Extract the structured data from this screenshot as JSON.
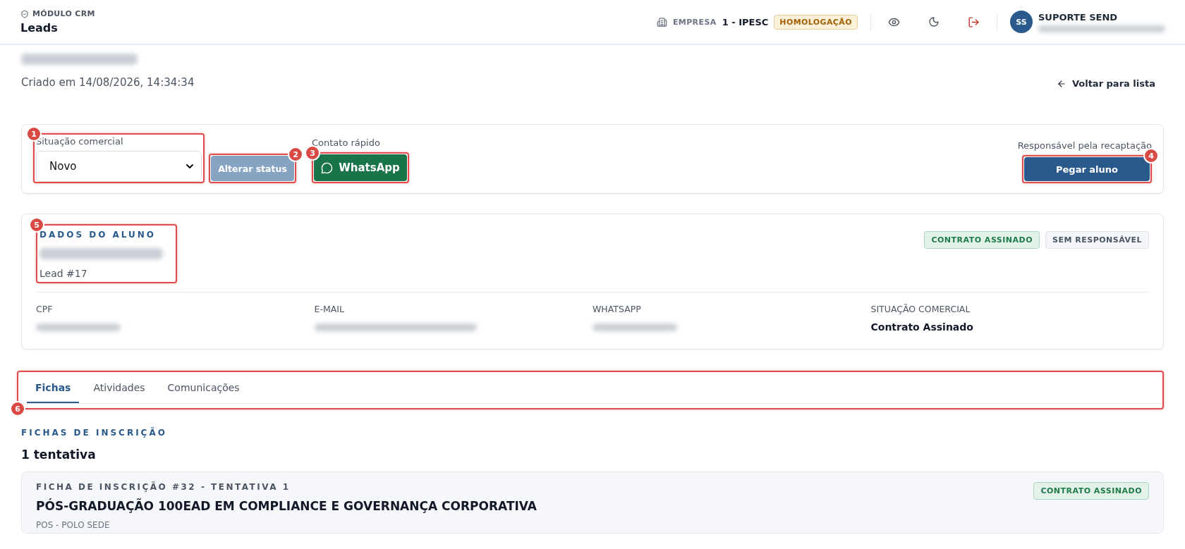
{
  "header": {
    "module_label": "MÓDULO CRM",
    "title": "Leads",
    "company_label": "EMPRESA",
    "company": "1 - IPESC",
    "env_badge": "HOMOLOGAÇÃO",
    "user": {
      "initials": "SS",
      "name": "SUPORTE SEND"
    }
  },
  "lead": {
    "created": "Criado em 14/08/2026, 14:34:34",
    "back_link": "Voltar para lista"
  },
  "actions": {
    "status_field": {
      "label": "Situação comercial",
      "value": "Novo",
      "marker": "1"
    },
    "alter_button": {
      "label": "Alterar status",
      "disabled": true,
      "marker": "2"
    },
    "quick_contact": {
      "label": "Contato rápido",
      "button": "WhatsApp",
      "marker": "3"
    },
    "responsible": {
      "label": "Responsável pela recaptação",
      "button": "Pegar aluno",
      "marker": "4"
    }
  },
  "student": {
    "heading": "DADOS DO ALUNO",
    "lead_id": "Lead #17",
    "marker": "5",
    "badges": [
      {
        "label": "CONTRATO ASSINADO",
        "kind": "success"
      },
      {
        "label": "SEM RESPONSÁVEL",
        "kind": "neutral"
      }
    ],
    "fields": [
      {
        "label": "CPF"
      },
      {
        "label": "E-MAIL"
      },
      {
        "label": "WHATSAPP"
      },
      {
        "label": "SITUAÇÃO COMERCIAL",
        "value": "Contrato Assinado"
      }
    ]
  },
  "tabs": {
    "marker": "6",
    "items": [
      {
        "label": "Fichas",
        "selected": true
      },
      {
        "label": "Atividades",
        "selected": false
      },
      {
        "label": "Comunicações",
        "selected": false
      }
    ]
  },
  "section": {
    "eyebrow": "FICHAS DE INSCRIÇÃO",
    "count": "1 tentativa"
  },
  "ficha": {
    "eyebrow": "FICHA DE INSCRIÇÃO #32 - TENTATIVA 1",
    "title": "PÓS-GRADUAÇÃO 100EAD EM COMPLIANCE E GOVERNANÇA CORPORATIVA",
    "badge": {
      "label": "CONTRATO ASSINADO",
      "kind": "success"
    },
    "subtitle": "POS - POLO SEDE"
  }
}
